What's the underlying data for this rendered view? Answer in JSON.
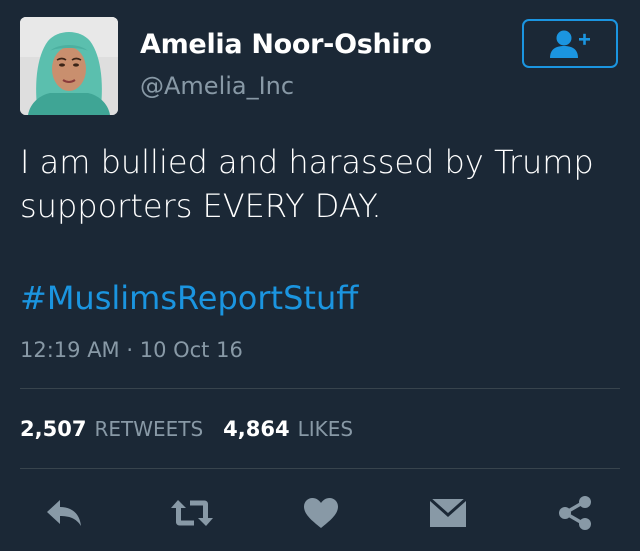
{
  "profile": {
    "display_name": "Amelia Noor-Oshiro",
    "handle": "@Amelia_Inc"
  },
  "tweet": {
    "text_line_1": "I am bullied and harassed by Trump",
    "text_line_2": "supporters EVERY DAY.",
    "hashtag": "#MuslimsReportStuff",
    "timestamp": "12:19 AM · 10 Oct 16"
  },
  "stats": {
    "retweets_count": "2,507",
    "retweets_label": "RETWEETS",
    "likes_count": "4,864",
    "likes_label": "LIKES"
  },
  "actions": [
    "reply-icon",
    "retweet-icon",
    "heart-icon",
    "message-icon",
    "share-icon"
  ],
  "colors": {
    "background": "#1b2836",
    "accent": "#1b95e0",
    "secondary_text": "#8899a6",
    "icon": "#8899a6"
  }
}
